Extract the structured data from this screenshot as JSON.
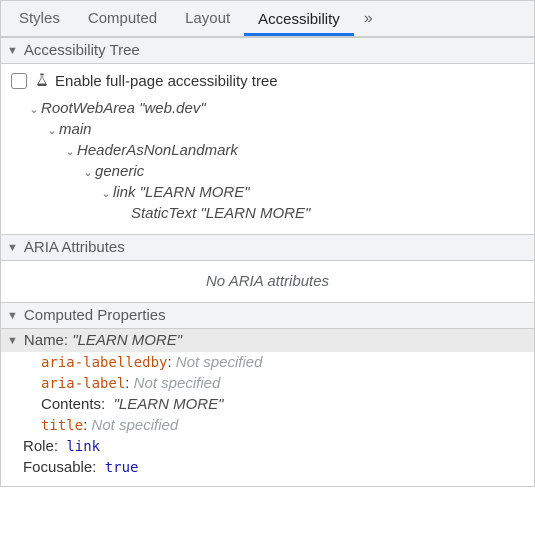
{
  "tabs": {
    "items": [
      "Styles",
      "Computed",
      "Layout",
      "Accessibility"
    ],
    "active_index": 3,
    "more_glyph": "»"
  },
  "sections": {
    "tree_title": "Accessibility Tree",
    "aria_title": "ARIA Attributes",
    "computed_title": "Computed Properties"
  },
  "tree": {
    "checkbox_label": "Enable full-page accessibility tree",
    "nodes": {
      "root_role": "RootWebArea",
      "root_name": "\"web.dev\"",
      "main": "main",
      "header": "HeaderAsNonLandmark",
      "generic": "generic",
      "link_role": "link",
      "link_name": "\"LEARN MORE\"",
      "static_text_role": "StaticText",
      "static_text_name": "\"LEARN MORE\""
    }
  },
  "aria": {
    "empty": "No ARIA attributes"
  },
  "computed": {
    "name_label": "Name:",
    "name_value": "\"LEARN MORE\"",
    "rows": {
      "aria_labelledby_key": "aria-labelledby",
      "aria_labelledby_val": "Not specified",
      "aria_label_key": "aria-label",
      "aria_label_val": "Not specified",
      "contents_key": "Contents:",
      "contents_val": "\"LEARN MORE\"",
      "title_key": "title",
      "title_val": "Not specified"
    },
    "role_label": "Role:",
    "role_value": "link",
    "focusable_label": "Focusable:",
    "focusable_value": "true"
  }
}
